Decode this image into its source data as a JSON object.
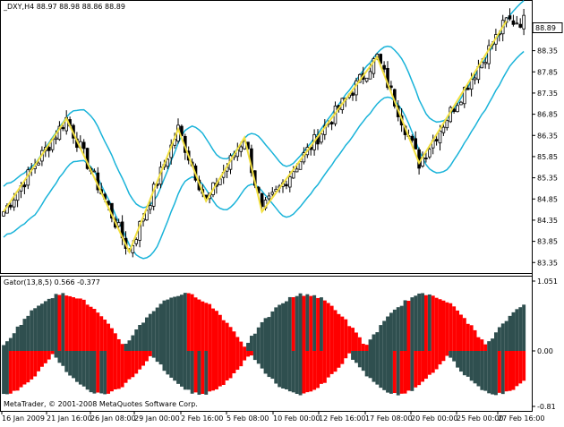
{
  "window": {
    "symbol_line": "_DXY,H4  88.97 88.98 88.86 88.89",
    "current_price_label": "88.89",
    "copyright": "MetaTrader, © 2001-2008 MetaQuotes Software Corp."
  },
  "colors": {
    "bull_candle": "#000000",
    "bear_candle": "#000000",
    "bands": "#19b3d9",
    "zigzag": "#f2e040",
    "gator_up": "#2f4f4f",
    "gator_down": "#ff0000",
    "price_box": "#ffffff"
  },
  "chart_data": [
    {
      "type": "candlestick",
      "title": "_DXY,H4  88.97 88.98 88.86 88.89",
      "ylim": [
        83.25,
        89.25
      ],
      "y_ticks": [
        "88.35",
        "87.85",
        "87.35",
        "86.85",
        "86.35",
        "85.85",
        "85.35",
        "84.85",
        "84.35",
        "83.85",
        "83.35"
      ],
      "y_tick_values": [
        88.35,
        87.85,
        87.35,
        86.85,
        86.35,
        85.85,
        85.35,
        84.85,
        84.35,
        83.85,
        83.35
      ],
      "x_ticks": [
        "16 Jan 2009",
        "21 Jan 16:00",
        "26 Jan 08:00",
        "29 Jan 00:00",
        "2 Feb 16:00",
        "5 Feb 08:00",
        "10 Feb 00:00",
        "12 Feb 16:00",
        "17 Feb 08:00",
        "20 Feb 00:00",
        "25 Feb 00:00",
        "27 Feb 16:00"
      ],
      "zigzag": [
        {
          "i": 0,
          "v": 84.55
        },
        {
          "i": 18,
          "v": 86.75
        },
        {
          "i": 36,
          "v": 83.6
        },
        {
          "i": 50,
          "v": 86.5
        },
        {
          "i": 58,
          "v": 84.8
        },
        {
          "i": 69,
          "v": 86.3
        },
        {
          "i": 74,
          "v": 84.55
        },
        {
          "i": 107,
          "v": 88.2
        },
        {
          "i": 119,
          "v": 85.7
        },
        {
          "i": 144,
          "v": 89.05
        }
      ],
      "current_price": 88.89
    },
    {
      "type": "bar",
      "title": "Gator(13,8,5) 0.566 -0.377",
      "ylim": [
        -0.81,
        1.051
      ],
      "y_ticks": [
        "1.051",
        "0.00",
        "-0.81"
      ],
      "y_tick_values": [
        1.051,
        0.0,
        -0.81
      ]
    }
  ]
}
